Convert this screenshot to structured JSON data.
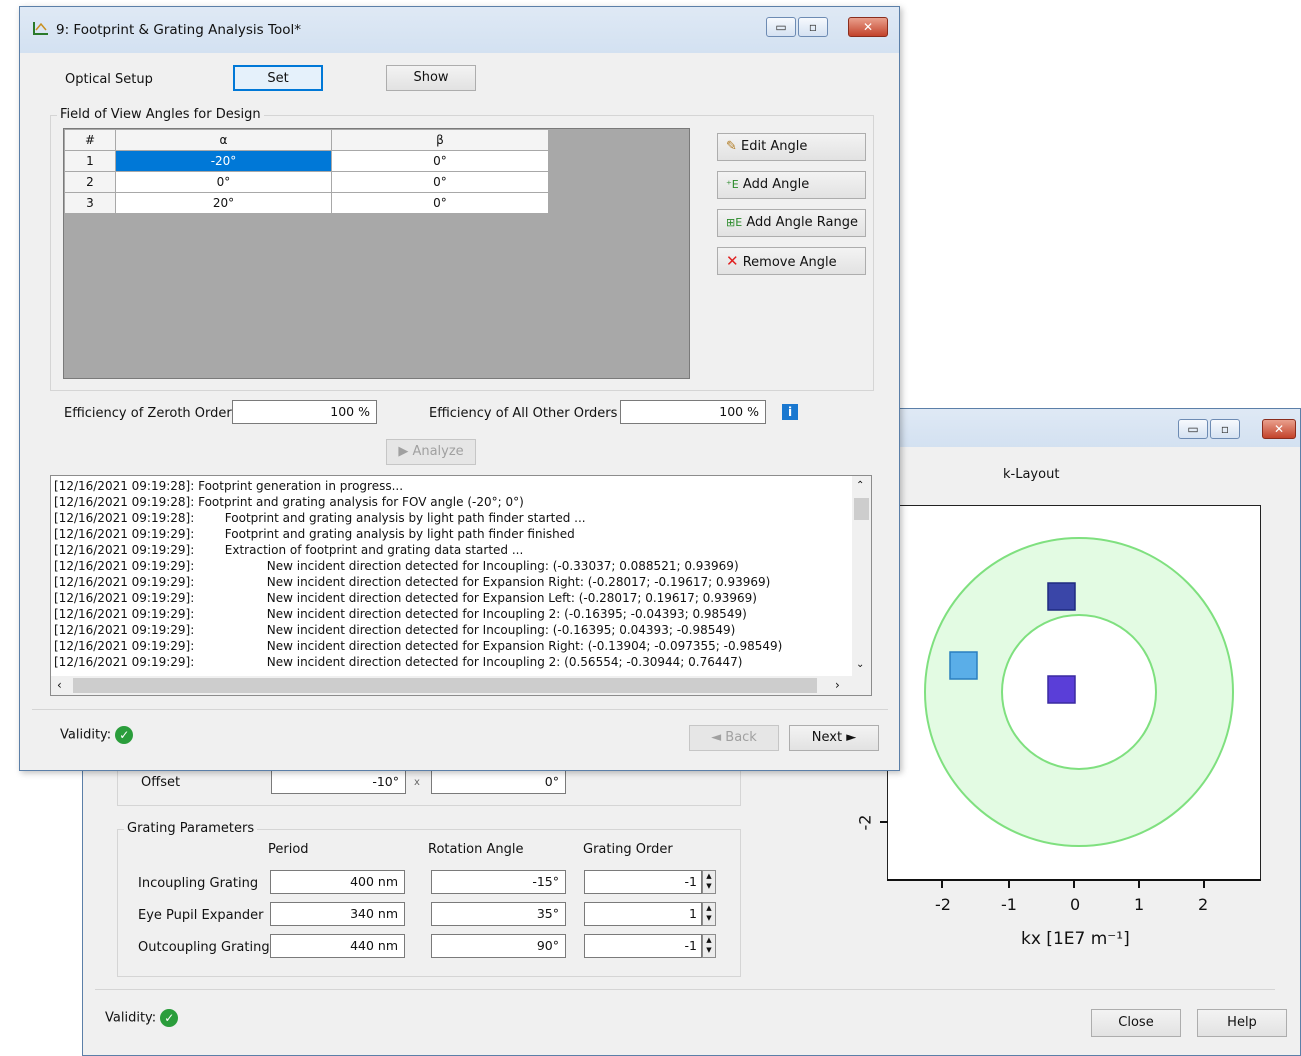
{
  "back_window": {
    "plot_title": "k-Layout",
    "x_ticks": [
      "-2",
      "-1",
      "0",
      "1",
      "2"
    ],
    "y_tick": "-2",
    "x_label": "kx [1E7 m⁻¹]",
    "offset_label": "Offset",
    "offset_x": "-10°",
    "offset_sep": "x",
    "offset_y": "0°",
    "grating_group_label": "Grating Parameters",
    "col_period": "Period",
    "col_rotation": "Rotation Angle",
    "col_order": "Grating Order",
    "gratings": [
      {
        "name": "Incoupling Grating",
        "period": "400 nm",
        "rotation": "-15°",
        "order": "-1"
      },
      {
        "name": "Eye Pupil Expander",
        "period": "340 nm",
        "rotation": "35°",
        "order": "1"
      },
      {
        "name": "Outcoupling Grating",
        "period": "440 nm",
        "rotation": "90°",
        "order": "-1"
      }
    ],
    "validity_label": "Validity:",
    "close_label": "Close",
    "help_label": "Help"
  },
  "front_window": {
    "title": "9: Footprint & Grating Analysis Tool*",
    "optical_setup_label": "Optical Setup",
    "set_label": "Set",
    "show_label": "Show",
    "fov_group_label": "Field of View Angles for Design",
    "table_headers": [
      "#",
      "α",
      "β"
    ],
    "table_rows": [
      {
        "n": "1",
        "alpha": "-20°",
        "beta": "0°"
      },
      {
        "n": "2",
        "alpha": "0°",
        "beta": "0°"
      },
      {
        "n": "3",
        "alpha": "20°",
        "beta": "0°"
      }
    ],
    "edit_angle_label": "Edit Angle",
    "add_angle_label": "Add Angle",
    "add_angle_range_label": "Add Angle Range",
    "remove_angle_label": "Remove Angle",
    "eff_zeroth_label": "Efficiency of Zeroth Order",
    "eff_zeroth_value": "100 %",
    "eff_other_label": "Efficiency of All Other Orders",
    "eff_other_value": "100 %",
    "analyze_label": "Analyze",
    "log_lines": [
      "[12/16/2021 09:19:28]: Footprint generation in progress...",
      "[12/16/2021 09:19:28]: Footprint and grating analysis for FOV angle (-20°; 0°)",
      "[12/16/2021 09:19:28]:        Footprint and grating analysis by light path finder started ...",
      "[12/16/2021 09:19:29]:        Footprint and grating analysis by light path finder finished",
      "[12/16/2021 09:19:29]:        Extraction of footprint and grating data started ...",
      "[12/16/2021 09:19:29]:                   New incident direction detected for Incoupling: (-0.33037; 0.088521; 0.93969)",
      "[12/16/2021 09:19:29]:                   New incident direction detected for Expansion Right: (-0.28017; -0.19617; 0.93969)",
      "[12/16/2021 09:19:29]:                   New incident direction detected for Expansion Left: (-0.28017; 0.19617; 0.93969)",
      "[12/16/2021 09:19:29]:                   New incident direction detected for Incoupling 2: (-0.16395; -0.04393; 0.98549)",
      "[12/16/2021 09:19:29]:                   New incident direction detected for Incoupling: (-0.16395; 0.04393; -0.98549)",
      "[12/16/2021 09:19:29]:                   New incident direction detected for Expansion Right: (-0.13904; -0.097355; -0.98549)",
      "[12/16/2021 09:19:29]:                   New incident direction detected for Incoupling 2: (0.56554; -0.30944; 0.76447)"
    ],
    "validity_label": "Validity:",
    "back_label": "◄ Back",
    "next_label": "Next ►"
  },
  "colors": {
    "ring_fill": "#e3fbe3",
    "ring_stroke": "#7fe07f",
    "square_blue": "#3a46a8",
    "square_light": "#5aaee8",
    "square_purple": "#5a3ed8",
    "selection": "#0078d7"
  }
}
